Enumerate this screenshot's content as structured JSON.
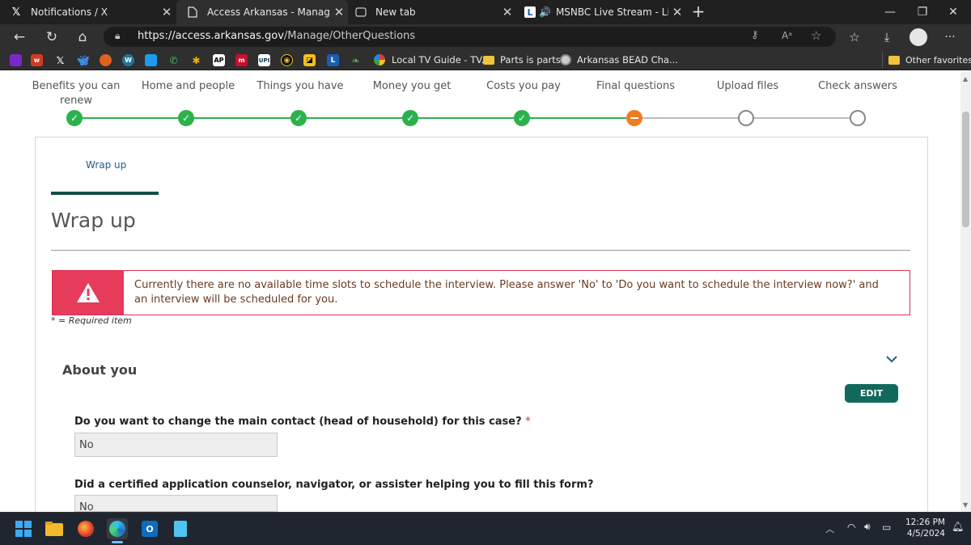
{
  "browser": {
    "tabs": [
      {
        "title": "Notifications / X",
        "icon": "x-logo-icon"
      },
      {
        "title": "Access Arkansas - Manage",
        "icon": "page-icon"
      },
      {
        "title": "New tab",
        "icon": "new-tab-icon"
      },
      {
        "title": "MSNBC Live Stream - Live N",
        "icon": "speaker-icon"
      }
    ],
    "url_host": "https://access.arkansas.gov",
    "url_path": "/Manage/OtherQuestions",
    "bookmarks": [
      {
        "label": "Local TV Guide - TV..."
      },
      {
        "label": "Parts is parts"
      },
      {
        "label": "Arkansas BEAD Cha..."
      }
    ],
    "other_favorites": "Other favorites",
    "favicon_labels": [
      "AP",
      "UPI"
    ]
  },
  "progress": {
    "steps": [
      {
        "label": "Benefits you can renew",
        "status": "done"
      },
      {
        "label": "Home and people",
        "status": "done"
      },
      {
        "label": "Things you have",
        "status": "done"
      },
      {
        "label": "Money you get",
        "status": "done"
      },
      {
        "label": "Costs you pay",
        "status": "done"
      },
      {
        "label": "Final questions",
        "status": "current"
      },
      {
        "label": "Upload files",
        "status": "todo"
      },
      {
        "label": "Check answers",
        "status": "todo"
      }
    ]
  },
  "page": {
    "subtab": "Wrap up",
    "title": "Wrap up",
    "alert": "Currently there are no available time slots to schedule the interview. Please answer 'No' to 'Do you want to schedule the interview now?' and an interview will be scheduled for you.",
    "required_note": "* = Required item",
    "section_title": "About you",
    "edit_label": "EDIT",
    "questions": [
      {
        "label": "Do you want to change the main contact (head of household) for this case?",
        "required_mark": "*",
        "value": "No"
      },
      {
        "label": "Did a certified application counselor, navigator, or assister helping you to fill this form?",
        "value": "No"
      }
    ]
  },
  "taskbar": {
    "time": "12:26 PM",
    "date": "4/5/2024"
  },
  "colors": {
    "done": "#2bb24c",
    "current": "#f07c22",
    "alert": "#e63b5a",
    "button": "#11695c",
    "subtab_underline": "#114e47"
  }
}
